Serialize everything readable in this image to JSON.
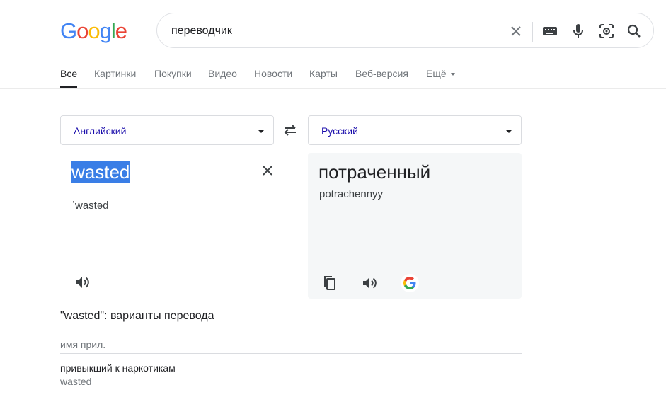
{
  "logo": {
    "letters": [
      "G",
      "o",
      "o",
      "g",
      "l",
      "e"
    ],
    "colors": [
      "#4285f4",
      "#ea4335",
      "#fbbc05",
      "#4285f4",
      "#34a853",
      "#ea4335"
    ]
  },
  "search": {
    "query": "переводчик"
  },
  "tabs": [
    {
      "label": "Все",
      "active": true
    },
    {
      "label": "Картинки"
    },
    {
      "label": "Покупки"
    },
    {
      "label": "Видео"
    },
    {
      "label": "Новости"
    },
    {
      "label": "Карты"
    },
    {
      "label": "Веб-версия"
    },
    {
      "label": "Ещё"
    }
  ],
  "translator": {
    "source_lang": "Английский",
    "target_lang": "Русский",
    "source_text": "wasted",
    "source_phonetic": "ˈwāstəd",
    "target_text": "потраченный",
    "target_transliteration": "potrachennyy"
  },
  "variants": {
    "title": "\"wasted\": варианты перевода",
    "part_of_speech": "имя прил.",
    "items": [
      {
        "translation": "привыкший к наркотикам",
        "back": "wasted"
      }
    ]
  },
  "colors": {
    "accent_link": "#1a0dab",
    "selection": "#3a7ee6",
    "target_bg": "#f5f7f8"
  },
  "icons": [
    "clear-icon",
    "keyboard-icon",
    "mic-icon",
    "lens-icon",
    "search-icon",
    "swap-icon",
    "speaker-icon",
    "copy-icon",
    "google-g-icon"
  ]
}
